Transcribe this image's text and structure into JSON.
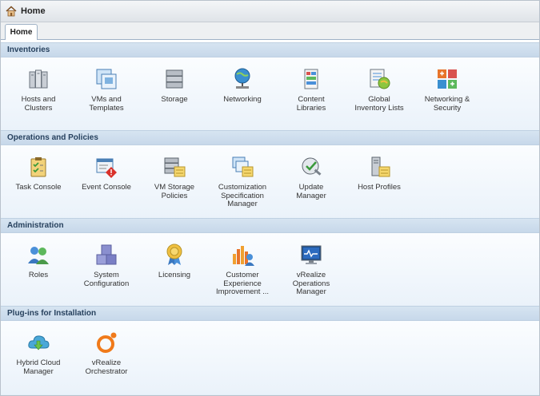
{
  "window": {
    "title": "Home"
  },
  "tabs": [
    {
      "label": "Home"
    }
  ],
  "sections": [
    {
      "title": "Inventories",
      "items": [
        {
          "label": "Hosts and\nClusters",
          "icon": "hosts-clusters-icon"
        },
        {
          "label": "VMs and\nTemplates",
          "icon": "vms-templates-icon"
        },
        {
          "label": "Storage",
          "icon": "storage-icon"
        },
        {
          "label": "Networking",
          "icon": "networking-icon"
        },
        {
          "label": "Content\nLibraries",
          "icon": "content-libraries-icon"
        },
        {
          "label": "Global\nInventory Lists",
          "icon": "global-inventory-icon"
        },
        {
          "label": "Networking &\nSecurity",
          "icon": "networking-security-icon"
        }
      ]
    },
    {
      "title": "Operations and Policies",
      "items": [
        {
          "label": "Task Console",
          "icon": "task-console-icon"
        },
        {
          "label": "Event Console",
          "icon": "event-console-icon"
        },
        {
          "label": "VM Storage\nPolicies",
          "icon": "vm-storage-policies-icon"
        },
        {
          "label": "Customization\nSpecification\nManager",
          "icon": "customization-spec-icon"
        },
        {
          "label": "Update\nManager",
          "icon": "update-manager-icon"
        },
        {
          "label": "Host Profiles",
          "icon": "host-profiles-icon"
        }
      ]
    },
    {
      "title": "Administration",
      "items": [
        {
          "label": "Roles",
          "icon": "roles-icon"
        },
        {
          "label": "System\nConfiguration",
          "icon": "system-configuration-icon"
        },
        {
          "label": "Licensing",
          "icon": "licensing-icon"
        },
        {
          "label": "Customer\nExperience\nImprovement ...",
          "icon": "ceip-icon"
        },
        {
          "label": "vRealize\nOperations\nManager",
          "icon": "vrealize-operations-icon"
        }
      ]
    },
    {
      "title": "Plug-ins for Installation",
      "items": [
        {
          "label": "Hybrid Cloud\nManager",
          "icon": "hybrid-cloud-icon"
        },
        {
          "label": "vRealize\nOrchestrator",
          "icon": "vrealize-orchestrator-icon"
        }
      ]
    }
  ]
}
